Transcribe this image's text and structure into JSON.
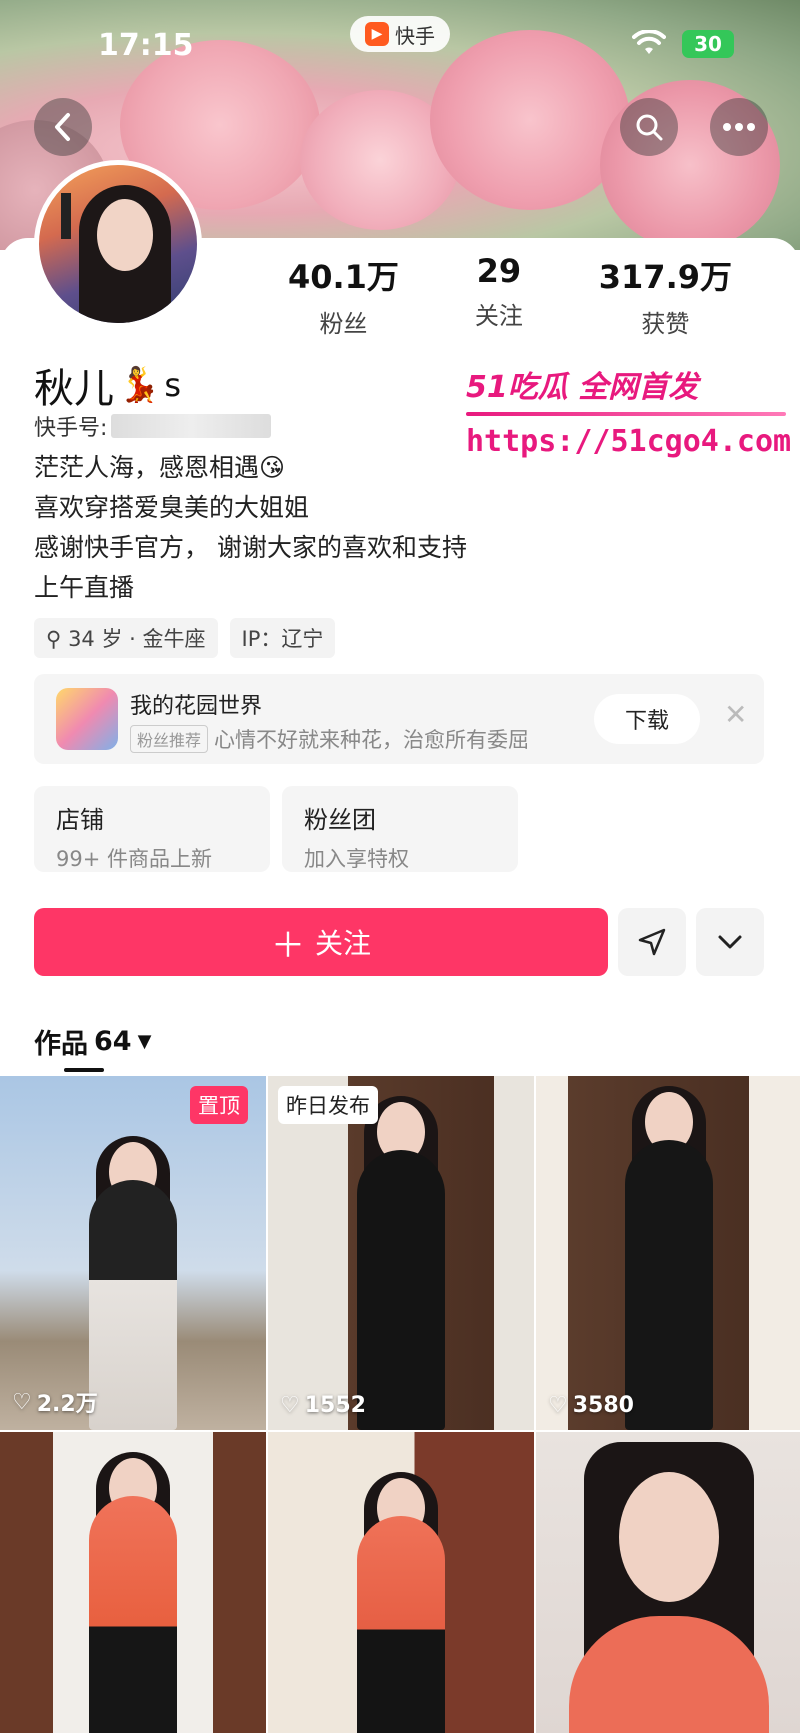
{
  "status_bar": {
    "time": "17:15",
    "app_name": "快手",
    "battery": "30"
  },
  "profile": {
    "followers": {
      "value": "40.1万",
      "label": "粉丝"
    },
    "following": {
      "value": "29",
      "label": "关注"
    },
    "likes": {
      "value": "317.9万",
      "label": "获赞"
    },
    "name": "秋儿",
    "name_suffix": "s",
    "id_label": "快手号:",
    "bio": [
      "茫茫人海，感恩相遇😘",
      "喜欢穿搭爱臭美的大姐姐",
      "感谢快手官方， 谢谢大家的喜欢和支持",
      "上午直播"
    ],
    "tags": [
      "34 岁 · 金牛座",
      "IP：辽宁"
    ]
  },
  "watermark": {
    "line1": "51吃瓜 全网首发",
    "url": "https://51cgo4.com"
  },
  "game_card": {
    "title": "我的花园世界",
    "badge": "粉丝推荐",
    "subtitle": "心情不好就来种花，治愈所有委屈",
    "download": "下载"
  },
  "features": [
    {
      "title": "店铺",
      "subtitle": "99+ 件商品上新"
    },
    {
      "title": "粉丝团",
      "subtitle": "加入享特权"
    }
  ],
  "actions": {
    "follow": "关注"
  },
  "works": {
    "label": "作品",
    "count": "64",
    "items": [
      {
        "badge": "置顶",
        "likes": "2.2万"
      },
      {
        "badge": "昨日发布",
        "likes": "1552"
      },
      {
        "badge": "",
        "likes": "3580"
      },
      {
        "badge": "",
        "likes": ""
      },
      {
        "badge": "",
        "likes": ""
      },
      {
        "badge": "",
        "likes": ""
      }
    ]
  }
}
